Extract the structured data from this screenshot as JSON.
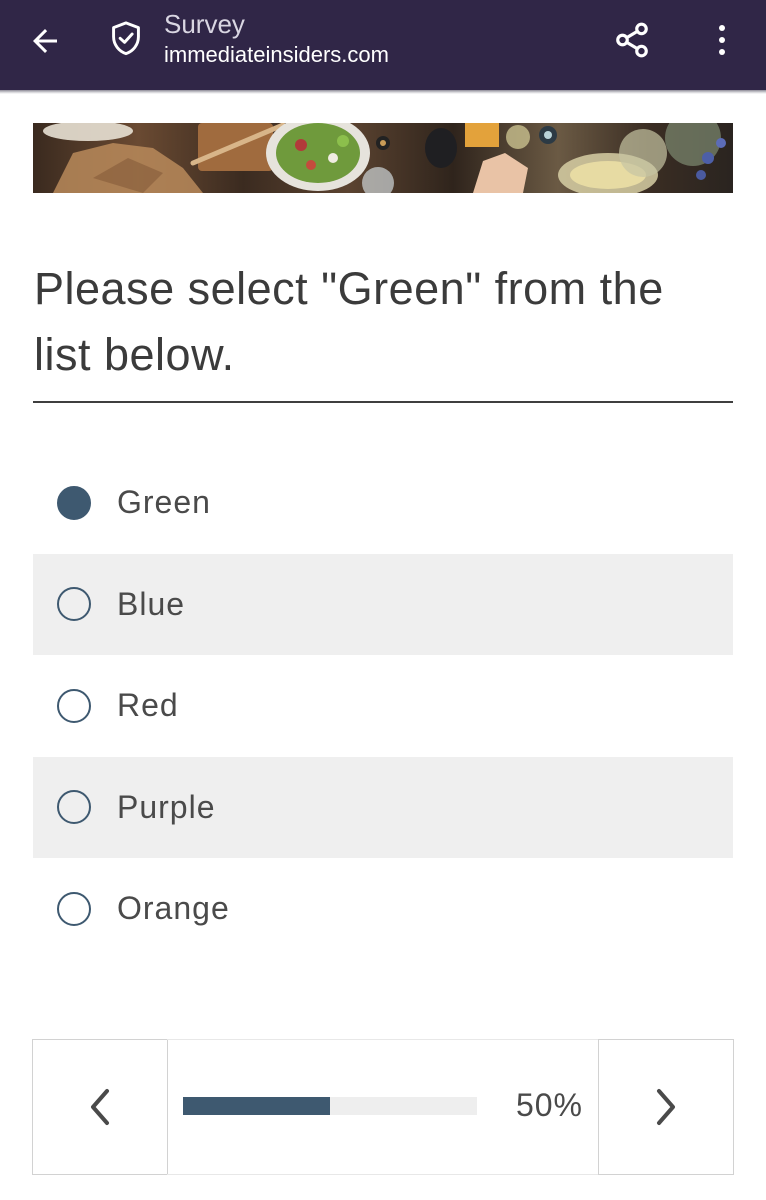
{
  "app_bar": {
    "title": "Survey",
    "url": "immediateinsiders.com",
    "back_icon": "arrow-left-icon",
    "security_icon": "shield-check-icon",
    "share_icon": "share-icon",
    "menu_icon": "more-vert-icon"
  },
  "question": {
    "text": "Please select \"Green\" from the list below."
  },
  "options": [
    {
      "label": "Green",
      "selected": true
    },
    {
      "label": "Blue",
      "selected": false
    },
    {
      "label": "Red",
      "selected": false
    },
    {
      "label": "Purple",
      "selected": false
    },
    {
      "label": "Orange",
      "selected": false
    }
  ],
  "progress": {
    "value": 0.5,
    "label": "50%"
  },
  "nav": {
    "prev_icon": "chevron-left-icon",
    "next_icon": "chevron-right-icon"
  },
  "colors": {
    "app_bar": "#302647",
    "accent": "#3e5970",
    "option_shade": "#efefef",
    "text": "#4a4a4a"
  }
}
